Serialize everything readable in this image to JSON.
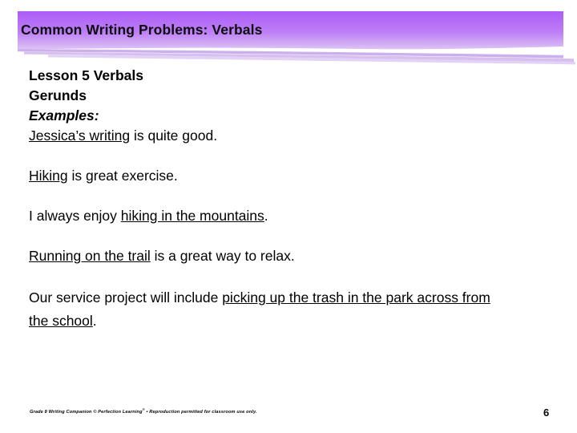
{
  "slide": {
    "title": "Common Writing Problems: Verbals",
    "banner": {
      "gradient_top": "#ac5cf5",
      "gradient_bottom": "#dcc4f3",
      "wave_color": "#cbb0ec",
      "wave_color_light": "#ddcaf2"
    },
    "body": {
      "heading_lesson": "Lesson 5  Verbals",
      "heading_type": "Gerunds",
      "heading_examples": "Examples:",
      "example_1": {
        "underlined": "Jessica’s writing",
        "rest": " is quite good."
      },
      "example_2": {
        "underlined": "Hiking",
        "rest": " is great exercise."
      },
      "example_3": {
        "prefix": "I always enjoy ",
        "underlined": "hiking in the mountains",
        "rest": "."
      },
      "example_4": {
        "underlined": "Running on the trail",
        "rest": " is a great way to relax."
      },
      "example_5": {
        "prefix": "Our service project will include ",
        "underlined": "picking up the trash in the park across from the school",
        "rest": "."
      }
    },
    "footer": {
      "credit_part1": "Grade 8 Writing Companion © Perfection Learning",
      "credit_reg": "®",
      "credit_part2": " • Reproduction permitted for classroom use only.",
      "page_number": "6"
    }
  }
}
